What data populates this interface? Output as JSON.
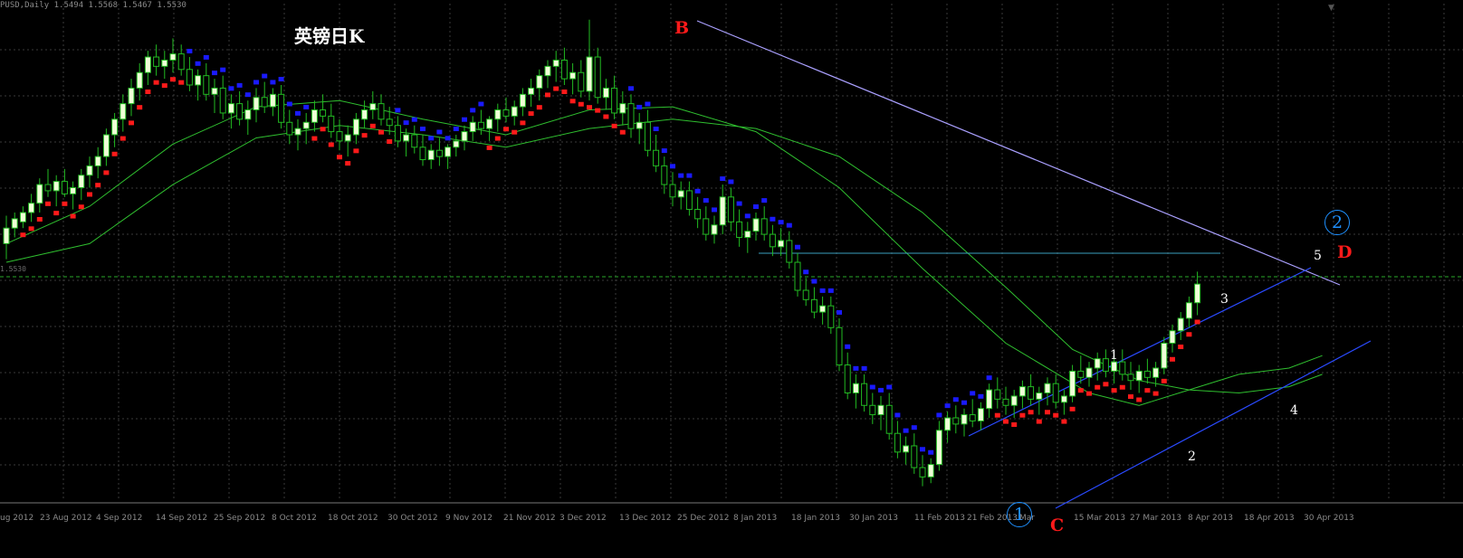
{
  "header": "PUSD,Daily  1.5494 1.5568 1.5467 1.5530",
  "title": "英镑日K",
  "colors": {
    "background": "#000000",
    "bull_body": "#f0ffd8",
    "bear_body": "#000000",
    "candle_outline": "#22bb22",
    "grid": "#3a3a3a",
    "ma": "#2fbf2f",
    "trend_up": "#ff1a1a",
    "trend_down": "#1a1aff",
    "resistance_line": "#aaa0ff",
    "channel": "#2a4aff",
    "horizontal_level": "#3aa0c0",
    "price_line": "#2aa82a",
    "annotation_red": "#ff1a1a",
    "annotation_blue": "#1e90ff",
    "annotation_white": "#ffffff"
  },
  "annotations": {
    "B": "B",
    "C": "C",
    "D": "D",
    "circle_1": "1",
    "circle_2": "2",
    "wave_1": "1",
    "wave_2": "2",
    "wave_3": "3",
    "wave_4": "4",
    "wave_5": "5"
  },
  "price_line_label": "1.5530",
  "corner_icon": "triangle-down-icon",
  "chart_data": {
    "type": "candlestick",
    "title": "英镑日K",
    "x_tick_labels": [
      "ug 2012",
      "23 Aug 2012",
      "4 Sep 2012",
      "14 Sep 2012",
      "25 Sep 2012",
      "8 Oct 2012",
      "18 Oct 2012",
      "30 Oct 2012",
      "9 Nov 2012",
      "21 Nov 2012",
      "3 Dec 2012",
      "13 Dec 2012",
      "25 Dec 2012",
      "8 Jan 2013",
      "18 Jan 2013",
      "30 Jan 2013",
      "11 Feb 2013",
      "21 Feb 2013",
      "Mar",
      "15 Mar 2013",
      "27 Mar 2013",
      "8 Apr 2013",
      "18 Apr 2013",
      "30 Apr 2013"
    ],
    "y_range": [
      1.485,
      1.642
    ],
    "candles": [
      {
        "o": 1.566,
        "h": 1.575,
        "l": 1.561,
        "c": 1.571
      },
      {
        "o": 1.571,
        "h": 1.576,
        "l": 1.568,
        "c": 1.574
      },
      {
        "o": 1.573,
        "h": 1.578,
        "l": 1.571,
        "c": 1.576
      },
      {
        "o": 1.576,
        "h": 1.582,
        "l": 1.573,
        "c": 1.579
      },
      {
        "o": 1.579,
        "h": 1.587,
        "l": 1.576,
        "c": 1.585
      },
      {
        "o": 1.585,
        "h": 1.59,
        "l": 1.581,
        "c": 1.583
      },
      {
        "o": 1.583,
        "h": 1.588,
        "l": 1.578,
        "c": 1.586
      },
      {
        "o": 1.586,
        "h": 1.59,
        "l": 1.581,
        "c": 1.582
      },
      {
        "o": 1.582,
        "h": 1.586,
        "l": 1.577,
        "c": 1.584
      },
      {
        "o": 1.584,
        "h": 1.59,
        "l": 1.58,
        "c": 1.588
      },
      {
        "o": 1.588,
        "h": 1.594,
        "l": 1.584,
        "c": 1.591
      },
      {
        "o": 1.591,
        "h": 1.597,
        "l": 1.587,
        "c": 1.594
      },
      {
        "o": 1.594,
        "h": 1.603,
        "l": 1.591,
        "c": 1.601
      },
      {
        "o": 1.601,
        "h": 1.608,
        "l": 1.597,
        "c": 1.606
      },
      {
        "o": 1.606,
        "h": 1.614,
        "l": 1.602,
        "c": 1.611
      },
      {
        "o": 1.611,
        "h": 1.619,
        "l": 1.607,
        "c": 1.616
      },
      {
        "o": 1.616,
        "h": 1.624,
        "l": 1.612,
        "c": 1.621
      },
      {
        "o": 1.621,
        "h": 1.628,
        "l": 1.617,
        "c": 1.626
      },
      {
        "o": 1.626,
        "h": 1.63,
        "l": 1.62,
        "c": 1.623
      },
      {
        "o": 1.623,
        "h": 1.628,
        "l": 1.619,
        "c": 1.625
      },
      {
        "o": 1.625,
        "h": 1.632,
        "l": 1.621,
        "c": 1.627
      },
      {
        "o": 1.627,
        "h": 1.63,
        "l": 1.62,
        "c": 1.622
      },
      {
        "o": 1.622,
        "h": 1.626,
        "l": 1.615,
        "c": 1.617
      },
      {
        "o": 1.617,
        "h": 1.622,
        "l": 1.612,
        "c": 1.62
      },
      {
        "o": 1.62,
        "h": 1.624,
        "l": 1.612,
        "c": 1.614
      },
      {
        "o": 1.614,
        "h": 1.619,
        "l": 1.608,
        "c": 1.616
      },
      {
        "o": 1.616,
        "h": 1.62,
        "l": 1.606,
        "c": 1.608
      },
      {
        "o": 1.608,
        "h": 1.614,
        "l": 1.603,
        "c": 1.611
      },
      {
        "o": 1.611,
        "h": 1.615,
        "l": 1.604,
        "c": 1.606
      },
      {
        "o": 1.606,
        "h": 1.612,
        "l": 1.601,
        "c": 1.609
      },
      {
        "o": 1.609,
        "h": 1.616,
        "l": 1.605,
        "c": 1.613
      },
      {
        "o": 1.613,
        "h": 1.618,
        "l": 1.608,
        "c": 1.61
      },
      {
        "o": 1.61,
        "h": 1.616,
        "l": 1.607,
        "c": 1.614
      },
      {
        "o": 1.614,
        "h": 1.617,
        "l": 1.603,
        "c": 1.605
      },
      {
        "o": 1.605,
        "h": 1.609,
        "l": 1.598,
        "c": 1.601
      },
      {
        "o": 1.601,
        "h": 1.606,
        "l": 1.596,
        "c": 1.603
      },
      {
        "o": 1.603,
        "h": 1.608,
        "l": 1.598,
        "c": 1.605
      },
      {
        "o": 1.605,
        "h": 1.612,
        "l": 1.602,
        "c": 1.609
      },
      {
        "o": 1.609,
        "h": 1.614,
        "l": 1.605,
        "c": 1.607
      },
      {
        "o": 1.607,
        "h": 1.611,
        "l": 1.6,
        "c": 1.602
      },
      {
        "o": 1.602,
        "h": 1.606,
        "l": 1.596,
        "c": 1.599
      },
      {
        "o": 1.599,
        "h": 1.604,
        "l": 1.594,
        "c": 1.601
      },
      {
        "o": 1.601,
        "h": 1.608,
        "l": 1.598,
        "c": 1.606
      },
      {
        "o": 1.606,
        "h": 1.612,
        "l": 1.603,
        "c": 1.609
      },
      {
        "o": 1.609,
        "h": 1.615,
        "l": 1.606,
        "c": 1.611
      },
      {
        "o": 1.611,
        "h": 1.614,
        "l": 1.604,
        "c": 1.606
      },
      {
        "o": 1.606,
        "h": 1.61,
        "l": 1.601,
        "c": 1.604
      },
      {
        "o": 1.604,
        "h": 1.607,
        "l": 1.597,
        "c": 1.599
      },
      {
        "o": 1.599,
        "h": 1.603,
        "l": 1.594,
        "c": 1.601
      },
      {
        "o": 1.601,
        "h": 1.604,
        "l": 1.595,
        "c": 1.597
      },
      {
        "o": 1.597,
        "h": 1.601,
        "l": 1.591,
        "c": 1.593
      },
      {
        "o": 1.593,
        "h": 1.598,
        "l": 1.59,
        "c": 1.596
      },
      {
        "o": 1.596,
        "h": 1.6,
        "l": 1.591,
        "c": 1.594
      },
      {
        "o": 1.594,
        "h": 1.598,
        "l": 1.59,
        "c": 1.597
      },
      {
        "o": 1.597,
        "h": 1.601,
        "l": 1.594,
        "c": 1.599
      },
      {
        "o": 1.599,
        "h": 1.604,
        "l": 1.596,
        "c": 1.602
      },
      {
        "o": 1.602,
        "h": 1.607,
        "l": 1.599,
        "c": 1.605
      },
      {
        "o": 1.605,
        "h": 1.609,
        "l": 1.601,
        "c": 1.603
      },
      {
        "o": 1.603,
        "h": 1.607,
        "l": 1.599,
        "c": 1.606
      },
      {
        "o": 1.606,
        "h": 1.611,
        "l": 1.602,
        "c": 1.609
      },
      {
        "o": 1.609,
        "h": 1.613,
        "l": 1.605,
        "c": 1.607
      },
      {
        "o": 1.607,
        "h": 1.612,
        "l": 1.604,
        "c": 1.61
      },
      {
        "o": 1.61,
        "h": 1.616,
        "l": 1.607,
        "c": 1.614
      },
      {
        "o": 1.614,
        "h": 1.619,
        "l": 1.61,
        "c": 1.616
      },
      {
        "o": 1.616,
        "h": 1.622,
        "l": 1.612,
        "c": 1.62
      },
      {
        "o": 1.62,
        "h": 1.625,
        "l": 1.616,
        "c": 1.623
      },
      {
        "o": 1.623,
        "h": 1.628,
        "l": 1.618,
        "c": 1.625
      },
      {
        "o": 1.625,
        "h": 1.629,
        "l": 1.617,
        "c": 1.619
      },
      {
        "o": 1.619,
        "h": 1.624,
        "l": 1.614,
        "c": 1.621
      },
      {
        "o": 1.621,
        "h": 1.625,
        "l": 1.613,
        "c": 1.615
      },
      {
        "o": 1.615,
        "h": 1.638,
        "l": 1.612,
        "c": 1.626
      },
      {
        "o": 1.626,
        "h": 1.629,
        "l": 1.611,
        "c": 1.613
      },
      {
        "o": 1.613,
        "h": 1.619,
        "l": 1.609,
        "c": 1.616
      },
      {
        "o": 1.616,
        "h": 1.62,
        "l": 1.606,
        "c": 1.608
      },
      {
        "o": 1.608,
        "h": 1.615,
        "l": 1.604,
        "c": 1.611
      },
      {
        "o": 1.611,
        "h": 1.614,
        "l": 1.6,
        "c": 1.603
      },
      {
        "o": 1.603,
        "h": 1.608,
        "l": 1.598,
        "c": 1.605
      },
      {
        "o": 1.605,
        "h": 1.609,
        "l": 1.594,
        "c": 1.596
      },
      {
        "o": 1.596,
        "h": 1.601,
        "l": 1.589,
        "c": 1.591
      },
      {
        "o": 1.591,
        "h": 1.594,
        "l": 1.582,
        "c": 1.585
      },
      {
        "o": 1.585,
        "h": 1.589,
        "l": 1.578,
        "c": 1.581
      },
      {
        "o": 1.581,
        "h": 1.586,
        "l": 1.577,
        "c": 1.583
      },
      {
        "o": 1.583,
        "h": 1.586,
        "l": 1.575,
        "c": 1.577
      },
      {
        "o": 1.577,
        "h": 1.581,
        "l": 1.571,
        "c": 1.574
      },
      {
        "o": 1.574,
        "h": 1.578,
        "l": 1.567,
        "c": 1.569
      },
      {
        "o": 1.569,
        "h": 1.575,
        "l": 1.566,
        "c": 1.572
      },
      {
        "o": 1.572,
        "h": 1.585,
        "l": 1.569,
        "c": 1.581
      },
      {
        "o": 1.581,
        "h": 1.584,
        "l": 1.57,
        "c": 1.573
      },
      {
        "o": 1.573,
        "h": 1.577,
        "l": 1.565,
        "c": 1.568
      },
      {
        "o": 1.568,
        "h": 1.573,
        "l": 1.563,
        "c": 1.57
      },
      {
        "o": 1.57,
        "h": 1.576,
        "l": 1.567,
        "c": 1.574
      },
      {
        "o": 1.574,
        "h": 1.578,
        "l": 1.567,
        "c": 1.569
      },
      {
        "o": 1.569,
        "h": 1.572,
        "l": 1.562,
        "c": 1.565
      },
      {
        "o": 1.565,
        "h": 1.571,
        "l": 1.562,
        "c": 1.567
      },
      {
        "o": 1.567,
        "h": 1.57,
        "l": 1.558,
        "c": 1.56
      },
      {
        "o": 1.56,
        "h": 1.563,
        "l": 1.549,
        "c": 1.551
      },
      {
        "o": 1.551,
        "h": 1.555,
        "l": 1.546,
        "c": 1.548
      },
      {
        "o": 1.548,
        "h": 1.552,
        "l": 1.542,
        "c": 1.544
      },
      {
        "o": 1.544,
        "h": 1.549,
        "l": 1.54,
        "c": 1.546
      },
      {
        "o": 1.546,
        "h": 1.549,
        "l": 1.537,
        "c": 1.539
      },
      {
        "o": 1.539,
        "h": 1.542,
        "l": 1.525,
        "c": 1.527
      },
      {
        "o": 1.527,
        "h": 1.531,
        "l": 1.516,
        "c": 1.518
      },
      {
        "o": 1.518,
        "h": 1.524,
        "l": 1.513,
        "c": 1.521
      },
      {
        "o": 1.521,
        "h": 1.524,
        "l": 1.512,
        "c": 1.514
      },
      {
        "o": 1.514,
        "h": 1.518,
        "l": 1.508,
        "c": 1.511
      },
      {
        "o": 1.511,
        "h": 1.517,
        "l": 1.506,
        "c": 1.514
      },
      {
        "o": 1.514,
        "h": 1.518,
        "l": 1.503,
        "c": 1.505
      },
      {
        "o": 1.505,
        "h": 1.509,
        "l": 1.497,
        "c": 1.499
      },
      {
        "o": 1.499,
        "h": 1.504,
        "l": 1.495,
        "c": 1.501
      },
      {
        "o": 1.501,
        "h": 1.505,
        "l": 1.492,
        "c": 1.494
      },
      {
        "o": 1.494,
        "h": 1.498,
        "l": 1.488,
        "c": 1.491
      },
      {
        "o": 1.491,
        "h": 1.497,
        "l": 1.489,
        "c": 1.495
      },
      {
        "o": 1.495,
        "h": 1.509,
        "l": 1.493,
        "c": 1.506
      },
      {
        "o": 1.506,
        "h": 1.512,
        "l": 1.502,
        "c": 1.51
      },
      {
        "o": 1.51,
        "h": 1.514,
        "l": 1.505,
        "c": 1.508
      },
      {
        "o": 1.508,
        "h": 1.513,
        "l": 1.504,
        "c": 1.511
      },
      {
        "o": 1.511,
        "h": 1.516,
        "l": 1.507,
        "c": 1.509
      },
      {
        "o": 1.509,
        "h": 1.515,
        "l": 1.506,
        "c": 1.513
      },
      {
        "o": 1.513,
        "h": 1.521,
        "l": 1.51,
        "c": 1.519
      },
      {
        "o": 1.519,
        "h": 1.523,
        "l": 1.513,
        "c": 1.516
      },
      {
        "o": 1.516,
        "h": 1.52,
        "l": 1.511,
        "c": 1.514
      },
      {
        "o": 1.514,
        "h": 1.519,
        "l": 1.51,
        "c": 1.517
      },
      {
        "o": 1.517,
        "h": 1.522,
        "l": 1.513,
        "c": 1.52
      },
      {
        "o": 1.52,
        "h": 1.524,
        "l": 1.514,
        "c": 1.516
      },
      {
        "o": 1.516,
        "h": 1.52,
        "l": 1.511,
        "c": 1.518
      },
      {
        "o": 1.518,
        "h": 1.523,
        "l": 1.514,
        "c": 1.521
      },
      {
        "o": 1.521,
        "h": 1.524,
        "l": 1.513,
        "c": 1.515
      },
      {
        "o": 1.515,
        "h": 1.519,
        "l": 1.511,
        "c": 1.517
      },
      {
        "o": 1.517,
        "h": 1.527,
        "l": 1.515,
        "c": 1.525
      },
      {
        "o": 1.525,
        "h": 1.53,
        "l": 1.521,
        "c": 1.523
      },
      {
        "o": 1.523,
        "h": 1.528,
        "l": 1.52,
        "c": 1.526
      },
      {
        "o": 1.526,
        "h": 1.531,
        "l": 1.522,
        "c": 1.529
      },
      {
        "o": 1.529,
        "h": 1.532,
        "l": 1.523,
        "c": 1.525
      },
      {
        "o": 1.525,
        "h": 1.53,
        "l": 1.521,
        "c": 1.528
      },
      {
        "o": 1.528,
        "h": 1.532,
        "l": 1.522,
        "c": 1.524
      },
      {
        "o": 1.524,
        "h": 1.528,
        "l": 1.519,
        "c": 1.522
      },
      {
        "o": 1.522,
        "h": 1.527,
        "l": 1.518,
        "c": 1.525
      },
      {
        "o": 1.525,
        "h": 1.529,
        "l": 1.521,
        "c": 1.523
      },
      {
        "o": 1.523,
        "h": 1.528,
        "l": 1.52,
        "c": 1.526
      },
      {
        "o": 1.526,
        "h": 1.536,
        "l": 1.524,
        "c": 1.534
      },
      {
        "o": 1.534,
        "h": 1.54,
        "l": 1.531,
        "c": 1.538
      },
      {
        "o": 1.538,
        "h": 1.544,
        "l": 1.535,
        "c": 1.542
      },
      {
        "o": 1.542,
        "h": 1.549,
        "l": 1.539,
        "c": 1.547
      },
      {
        "o": 1.547,
        "h": 1.557,
        "l": 1.543,
        "c": 1.553
      }
    ],
    "ma_fast": [
      [
        0,
        1.566
      ],
      [
        10,
        1.578
      ],
      [
        20,
        1.598
      ],
      [
        30,
        1.61
      ],
      [
        40,
        1.612
      ],
      [
        50,
        1.606
      ],
      [
        60,
        1.601
      ],
      [
        70,
        1.609
      ],
      [
        80,
        1.61
      ],
      [
        90,
        1.602
      ],
      [
        100,
        1.584
      ],
      [
        110,
        1.558
      ],
      [
        120,
        1.534
      ],
      [
        130,
        1.518
      ],
      [
        136,
        1.514
      ],
      [
        142,
        1.519
      ],
      [
        148,
        1.524
      ],
      [
        154,
        1.526
      ],
      [
        158,
        1.53
      ]
    ],
    "ma_slow": [
      [
        0,
        1.56
      ],
      [
        10,
        1.566
      ],
      [
        20,
        1.585
      ],
      [
        30,
        1.6
      ],
      [
        40,
        1.604
      ],
      [
        50,
        1.601
      ],
      [
        60,
        1.597
      ],
      [
        70,
        1.603
      ],
      [
        80,
        1.606
      ],
      [
        90,
        1.603
      ],
      [
        100,
        1.594
      ],
      [
        110,
        1.576
      ],
      [
        120,
        1.552
      ],
      [
        128,
        1.532
      ],
      [
        136,
        1.522
      ],
      [
        142,
        1.519
      ],
      [
        148,
        1.518
      ],
      [
        154,
        1.52
      ],
      [
        158,
        1.524
      ]
    ],
    "trend_dots": [
      {
        "from": 2,
        "to": 21,
        "side": "up"
      },
      {
        "from": 22,
        "to": 36,
        "side": "down"
      },
      {
        "from": 37,
        "to": 46,
        "side": "up"
      },
      {
        "from": 47,
        "to": 57,
        "side": "down"
      },
      {
        "from": 58,
        "to": 74,
        "side": "up"
      },
      {
        "from": 75,
        "to": 118,
        "side": "down"
      },
      {
        "from": 119,
        "to": 145,
        "side": "up"
      },
      {
        "from": 146,
        "to": 152,
        "side": "down"
      },
      {
        "from": 153,
        "to": 158,
        "side": "up"
      }
    ]
  }
}
